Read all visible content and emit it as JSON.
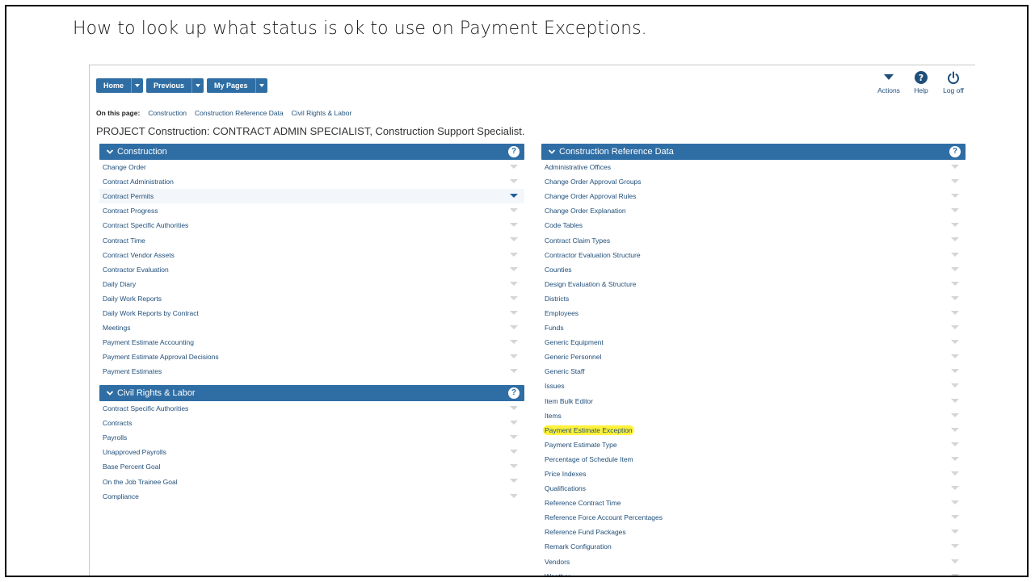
{
  "slide_title": "How to look up what status is ok to use on Payment Exceptions.",
  "nav": {
    "home": "Home",
    "previous": "Previous",
    "my_pages": "My Pages",
    "actions": "Actions",
    "help": "Help",
    "logoff": "Log off"
  },
  "on_this_page": {
    "label": "On this page:",
    "links": [
      "Construction",
      "Construction Reference Data",
      "Civil Rights & Labor"
    ]
  },
  "project_title": "PROJECT Construction: CONTRACT ADMIN SPECIALIST, Construction Support Specialist.",
  "construction": {
    "title": "Construction",
    "items": [
      "Change Order",
      "Contract Administration",
      "Contract Permits",
      "Contract Progress",
      "Contract Specific Authorities",
      "Contract Time",
      "Contract Vendor Assets",
      "Contractor Evaluation",
      "Daily Diary",
      "Daily Work Reports",
      "Daily Work Reports by Contract",
      "Meetings",
      "Payment Estimate Accounting",
      "Payment Estimate Approval Decisions",
      "Payment Estimates"
    ]
  },
  "civil_rights": {
    "title": "Civil Rights & Labor",
    "items": [
      "Contract Specific Authorities",
      "Contracts",
      "Payrolls",
      "Unapproved Payrolls",
      "Base Percent Goal",
      "On the Job Trainee Goal",
      "Compliance"
    ]
  },
  "reference": {
    "title": "Construction Reference Data",
    "items": [
      "Administrative Offices",
      "Change Order Approval Groups",
      "Change Order Approval Rules",
      "Change Order Explanation",
      "Code Tables",
      "Contract Claim Types",
      "Contractor Evaluation Structure",
      "Counties",
      "Design Evaluation & Structure",
      "Districts",
      "Employees",
      "Funds",
      "Generic Equipment",
      "Generic Personnel",
      "Generic Staff",
      "Issues",
      "Item Bulk Editor",
      "Items",
      "Payment Estimate Exception",
      "Payment Estimate Type",
      "Percentage of Schedule Item",
      "Price Indexes",
      "Qualifications",
      "Reference Contract Time",
      "Reference Force Account Percentages",
      "Reference Fund Packages",
      "Remark Configuration",
      "Vendors",
      "Weather"
    ]
  },
  "help_glyph": "?",
  "colors": {
    "accent": "#2f6ea5",
    "link": "#1f4e79",
    "highlight": "#fff23b"
  }
}
